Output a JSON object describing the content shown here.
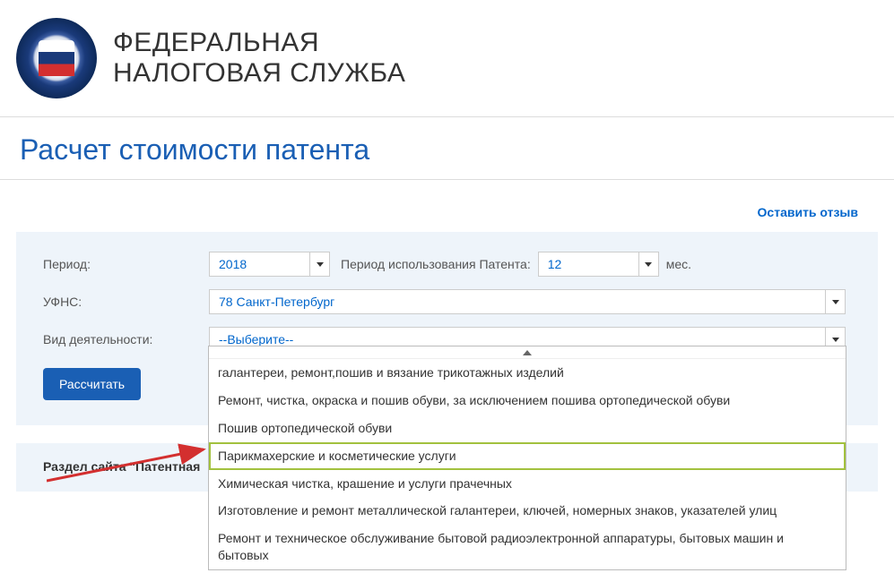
{
  "header": {
    "org_line1": "ФЕДЕРАЛЬНАЯ",
    "org_line2": "НАЛОГОВАЯ СЛУЖБА"
  },
  "page_title": "Расчет стоимости патента",
  "feedback_link": "Оставить отзыв",
  "form": {
    "period_label": "Период:",
    "year_value": "2018",
    "period_usage_label": "Период использования Патента:",
    "months_value": "12",
    "months_suffix": "мес.",
    "ufns_label": "УФНС:",
    "ufns_value": "78 Санкт-Петербург",
    "activity_label": "Вид деятельности:",
    "activity_value": "--Выберите--",
    "calculate_button": "Рассчитать"
  },
  "dropdown": {
    "items": [
      "галантереи, ремонт,пошив и вязание трикотажных изделий",
      "Ремонт, чистка, окраска и пошив обуви, за исключением пошива ортопедической обуви",
      "Пошив ортопедической обуви",
      "Парикмахерские и косметические услуги",
      "Химическая чистка, крашение и услуги прачечных",
      "Изготовление и ремонт металлической галантереи, ключей, номерных знаков, указателей улиц",
      "Ремонт и техническое обслуживание бытовой радиоэлектронной аппаратуры, бытовых машин и бытовых"
    ],
    "highlighted_index": 3
  },
  "section_link": "Раздел сайта \"Патентная"
}
